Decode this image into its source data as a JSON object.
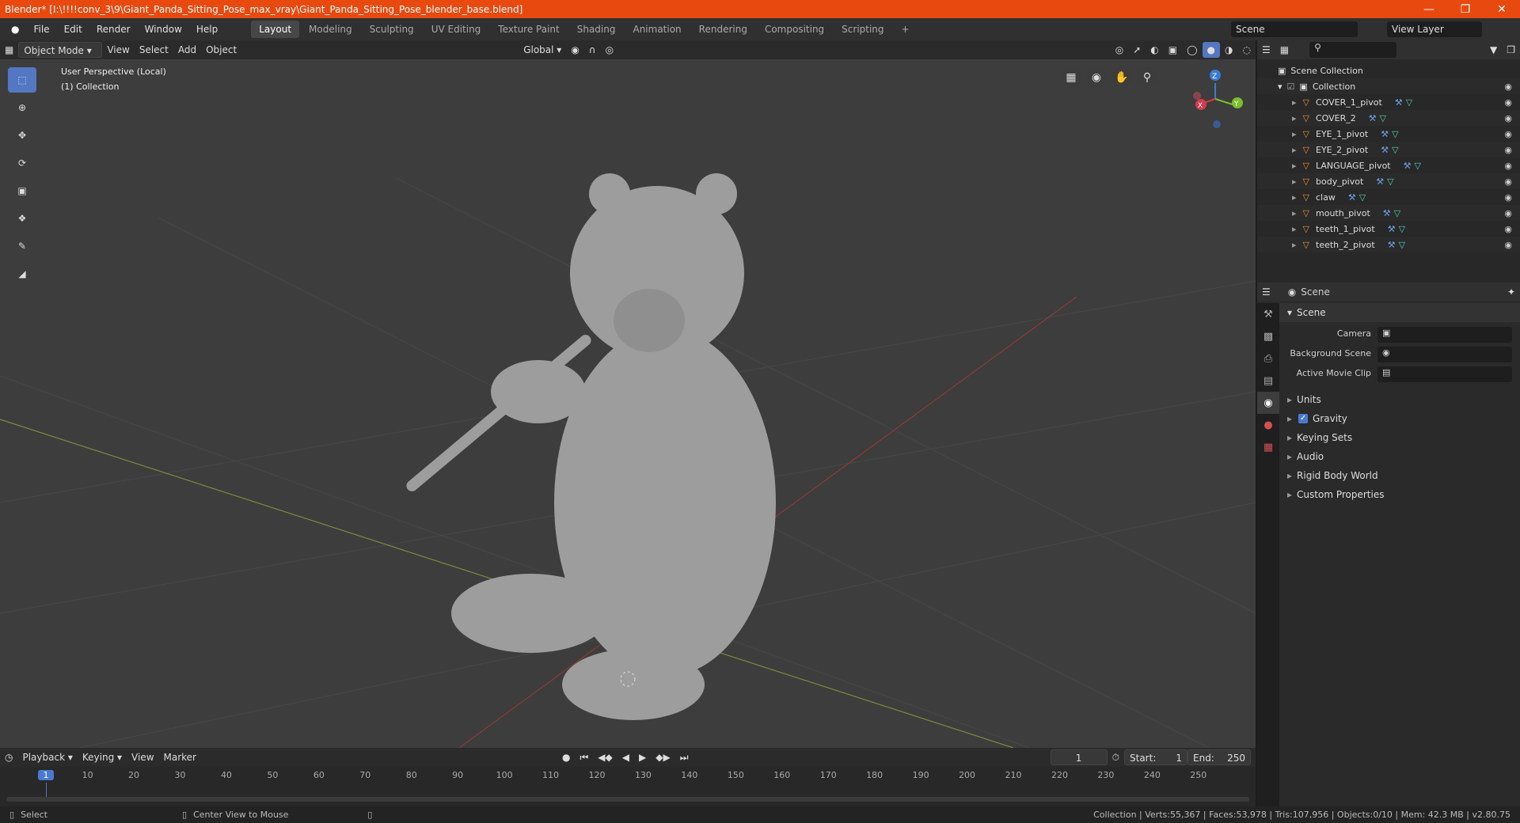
{
  "title": "Blender* [I:\\!!!!conv_3\\9\\Giant_Panda_Sitting_Pose_max_vray\\Giant_Panda_Sitting_Pose_blender_base.blend]",
  "menus": [
    "File",
    "Edit",
    "Render",
    "Window",
    "Help"
  ],
  "workspaces": [
    "Layout",
    "Modeling",
    "Sculpting",
    "UV Editing",
    "Texture Paint",
    "Shading",
    "Animation",
    "Rendering",
    "Compositing",
    "Scripting"
  ],
  "scene_name": "Scene",
  "view_layer": "View Layer",
  "viewport_header": {
    "mode": "Object Mode",
    "menus": [
      "View",
      "Select",
      "Add",
      "Object"
    ],
    "orientation": "Global"
  },
  "viewport": {
    "perspective": "User Perspective (Local)",
    "collection": "(1) Collection"
  },
  "gizmo": {
    "x": "X",
    "y": "Y",
    "z": "Z"
  },
  "outliner": {
    "root": "Scene Collection",
    "collection": "Collection",
    "items": [
      "COVER_1_pivot",
      "COVER_2",
      "EYE_1_pivot",
      "EYE_2_pivot",
      "LANGUAGE_pivot",
      "body_pivot",
      "claw",
      "mouth_pivot",
      "teeth_1_pivot",
      "teeth_2_pivot"
    ]
  },
  "properties": {
    "header": "Scene",
    "panel": "Scene",
    "camera_label": "Camera",
    "background_label": "Background Scene",
    "movieclip_label": "Active Movie Clip",
    "sections": [
      "Units",
      "Gravity",
      "Keying Sets",
      "Audio",
      "Rigid Body World",
      "Custom Properties"
    ]
  },
  "timeline": {
    "menus": [
      "Playback",
      "Keying",
      "View",
      "Marker"
    ],
    "current_frame": "1",
    "start_label": "Start:",
    "start": "1",
    "end_label": "End:",
    "end": "250",
    "ticks": [
      "1",
      "10",
      "20",
      "30",
      "40",
      "50",
      "60",
      "70",
      "80",
      "90",
      "100",
      "110",
      "120",
      "130",
      "140",
      "150",
      "160",
      "170",
      "180",
      "190",
      "200",
      "210",
      "220",
      "230",
      "240",
      "250"
    ]
  },
  "status": {
    "left": "Select",
    "middle": "Center View to Mouse",
    "right": "Collection | Verts:55,367 | Faces:53,978 | Tris:107,956 | Objects:0/10 | Mem: 42.3 MB | v2.80.75"
  }
}
